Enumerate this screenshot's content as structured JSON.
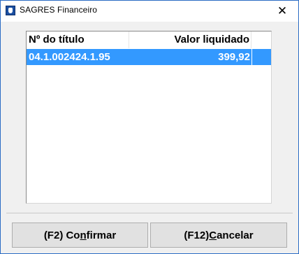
{
  "window": {
    "title": "SAGRES Financeiro"
  },
  "list": {
    "columns": [
      "Nº do título",
      "Valor liquidado"
    ],
    "rows": [
      {
        "titulo": "04.1.002424.1.95",
        "valor": "399,92"
      }
    ]
  },
  "buttons": {
    "confirm": {
      "prefix": "(F2) Co",
      "accel": "n",
      "suffix": "firmar"
    },
    "cancel": {
      "prefix": "(F12) ",
      "accel": "C",
      "suffix": "ancelar"
    }
  },
  "colors": {
    "selection": "#3399ff",
    "window_border": "#2b6cc4"
  }
}
